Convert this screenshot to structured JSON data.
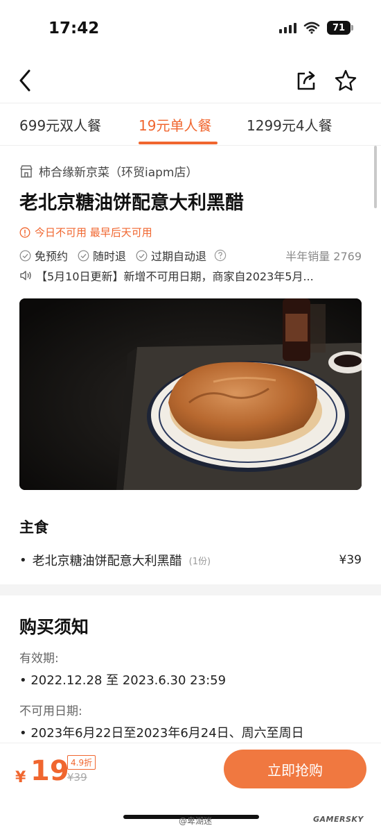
{
  "status_bar": {
    "time": "17:42",
    "battery": "71"
  },
  "tabs": [
    {
      "label": "699元双人餐"
    },
    {
      "label": "19元单人餐",
      "active": true
    },
    {
      "label": "1299元4人餐"
    }
  ],
  "deal": {
    "store": "柿合缘新京菜（环贸iapm店）",
    "title": "老北京糖油饼配意大利黑醋",
    "availability": "今日不可用 最早后天可用",
    "features": [
      "免预约",
      "随时退",
      "过期自动退"
    ],
    "sales": "半年销量 2769",
    "notice": "【5月10日更新】新增不可用日期，商家自2023年5月..."
  },
  "menu": {
    "heading": "主食",
    "items": [
      {
        "name": "老北京糖油饼配意大利黑醋",
        "qty": "(1份)",
        "price": "¥39"
      }
    ]
  },
  "purchase_notes": {
    "heading": "购买须知",
    "validity_label": "有效期:",
    "validity_value": "2022.12.28 至 2023.6.30 23:59",
    "unavailable_label": "不可用日期:",
    "unavailable_value": "2023年6月22日至2023年6月24日、周六至周日"
  },
  "bottom": {
    "currency": "¥",
    "price": "19",
    "discount": "4.9折",
    "original_price": "¥39",
    "buy_label": "立即抢购"
  },
  "watermark": {
    "left": "@卑湖迷",
    "right": "GAMERSKY"
  },
  "colors": {
    "accent": "#f0662f",
    "button": "#f07840"
  },
  "icons": {
    "back": "chevron-left-icon",
    "share": "share-icon",
    "favorite": "star-icon",
    "store": "store-icon",
    "info": "info-icon",
    "check": "check-circle-icon",
    "help": "question-icon",
    "speaker": "speaker-icon"
  }
}
